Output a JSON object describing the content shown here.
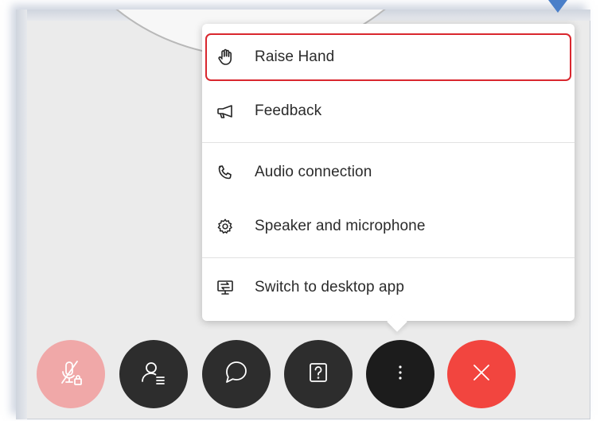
{
  "menu": {
    "items": [
      {
        "label": "Raise Hand",
        "icon": "hand-icon"
      },
      {
        "label": "Feedback",
        "icon": "megaphone-icon"
      },
      {
        "label": "Audio connection",
        "icon": "phone-icon"
      },
      {
        "label": "Speaker and microphone",
        "icon": "gear-icon"
      },
      {
        "label": "Switch to desktop app",
        "icon": "desktop-switch-icon"
      }
    ],
    "highlighted_item": "Raise Hand"
  },
  "controls": [
    {
      "name": "mute",
      "icon": "microphone-muted-locked-icon",
      "color": "#f0a8a8"
    },
    {
      "name": "participants",
      "icon": "participants-icon",
      "color": "#2d2d2d"
    },
    {
      "name": "chat",
      "icon": "chat-bubble-icon",
      "color": "#2d2d2d"
    },
    {
      "name": "help",
      "icon": "question-icon",
      "color": "#2d2d2d"
    },
    {
      "name": "more",
      "icon": "more-vertical-icon",
      "color": "#1c1c1c"
    },
    {
      "name": "end",
      "icon": "close-icon",
      "color": "#f2453f"
    }
  ],
  "colors": {
    "highlight_border": "#d9272e",
    "pointer_arrow": "#4a7fc9"
  }
}
